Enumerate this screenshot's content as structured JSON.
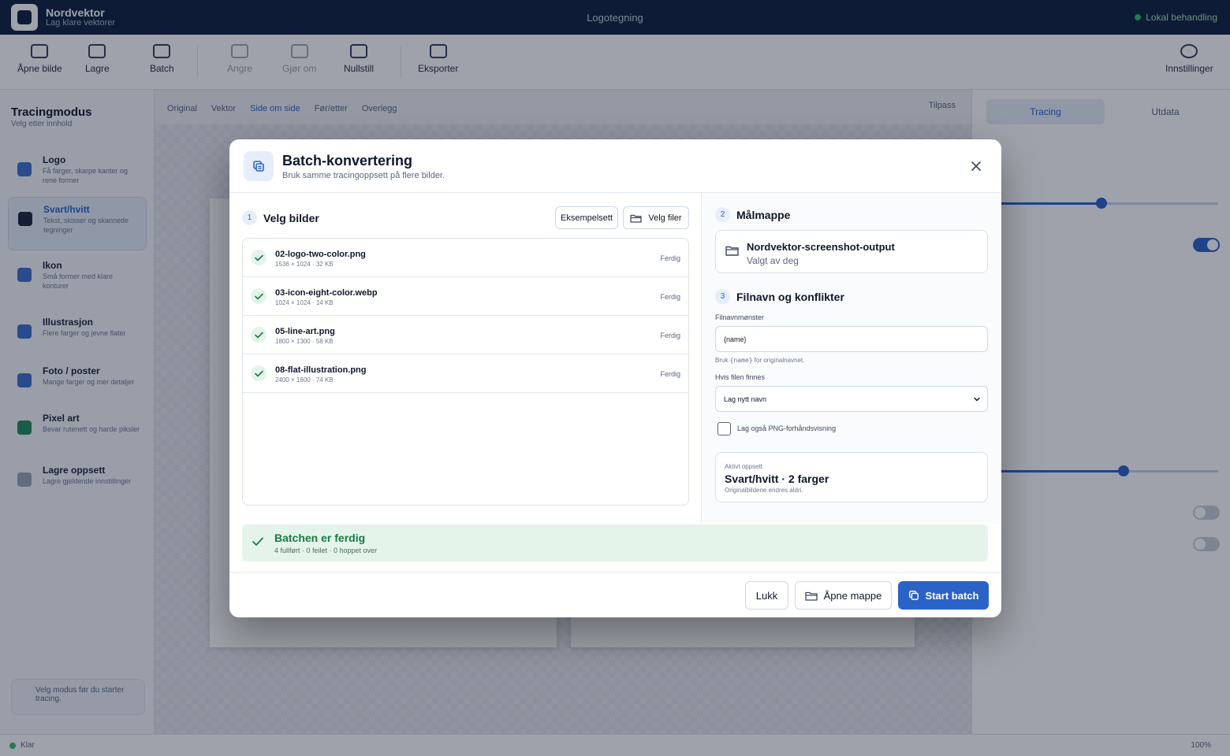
{
  "app": {
    "name": "Nordvektor",
    "tagline": "Lag klare vektorer",
    "window_title": "Logotegning",
    "status_right": "Lokal behandling"
  },
  "toolbar": {
    "open_images": "Åpne bilde",
    "save": "Lagre",
    "batch": "Batch",
    "undo": "Angre",
    "redo": "Gjør om",
    "reset": "Nullstill",
    "export": "Eksporter",
    "settings": "Innstillinger"
  },
  "sidebar": {
    "title": "Tracingmodus",
    "subtitle": "Velg etter innhold",
    "items": [
      {
        "title": "Logo",
        "desc": "Få farger, skarpe kanter og rene former"
      },
      {
        "title": "Svart/hvitt",
        "desc": "Tekst, skisser og skannede tegninger"
      },
      {
        "title": "Ikon",
        "desc": "Små former med klare konturer"
      },
      {
        "title": "Illustrasjon",
        "desc": "Flere farger og jevne flater"
      },
      {
        "title": "Foto / poster",
        "desc": "Mange farger og mer detaljer"
      },
      {
        "title": "Pixel art",
        "desc": "Bevar rutenett og harde piksler"
      },
      {
        "title": "Lagre oppsett",
        "desc": "Lagre gjeldende innstillinger"
      }
    ],
    "hint": "Velg modus før du starter tracing."
  },
  "canvas": {
    "tabs": [
      "Original",
      "Vektor",
      "Side om side",
      "Før/etter",
      "Overlegg"
    ],
    "fit": "Tilpass"
  },
  "rpanel": {
    "tab_tracing": "Tracing",
    "tab_output": "Utdata"
  },
  "status": {
    "left": "Klar",
    "zoom": "100%"
  },
  "modal": {
    "title": "Batch-konvertering",
    "subtitle": "Bruk samme tracingoppsett på flere bilder.",
    "step1": {
      "num": "1",
      "label": "Velg bilder"
    },
    "sample_button": "Eksempelsett",
    "choose_files_button": "Velg filer",
    "files": [
      {
        "name": "02-logo-two-color.png",
        "meta": "1536 × 1024 · 32 KB",
        "status": "Ferdig"
      },
      {
        "name": "03-icon-eight-color.webp",
        "meta": "1024 × 1024 · 14 KB",
        "status": "Ferdig"
      },
      {
        "name": "05-line-art.png",
        "meta": "1800 × 1300 · 58 KB",
        "status": "Ferdig"
      },
      {
        "name": "08-flat-illustration.png",
        "meta": "2400 × 1600 · 74 KB",
        "status": "Ferdig"
      }
    ],
    "step2": {
      "num": "2",
      "label": "Målmappe"
    },
    "target": {
      "name": "Nordvektor-screenshot-output",
      "sub": "Valgt av deg"
    },
    "step3": {
      "num": "3",
      "label": "Filnavn og konflikter"
    },
    "filename_label": "Filnavnmønster",
    "filename_value": "{name}",
    "filename_hint_prefix": "Bruk ",
    "filename_hint_code": "{name}",
    "filename_hint_suffix": " for originalnavnet.",
    "conflict_label": "Hvis filen finnes",
    "conflict_value": "Lag nytt navn",
    "png_preview_label": "Lag også PNG-forhåndsvisning",
    "preset": {
      "caption": "Aktivt oppsett",
      "name": "Svart/hvitt · 2 farger",
      "note": "Originalbildene endres aldri."
    },
    "banner": {
      "title": "Batchen er ferdig",
      "sub": "4 fullført · 0 feilet · 0 hoppet over"
    },
    "close_button": "Lukk",
    "open_folder_button": "Åpne mappe",
    "start_button": "Start batch"
  }
}
